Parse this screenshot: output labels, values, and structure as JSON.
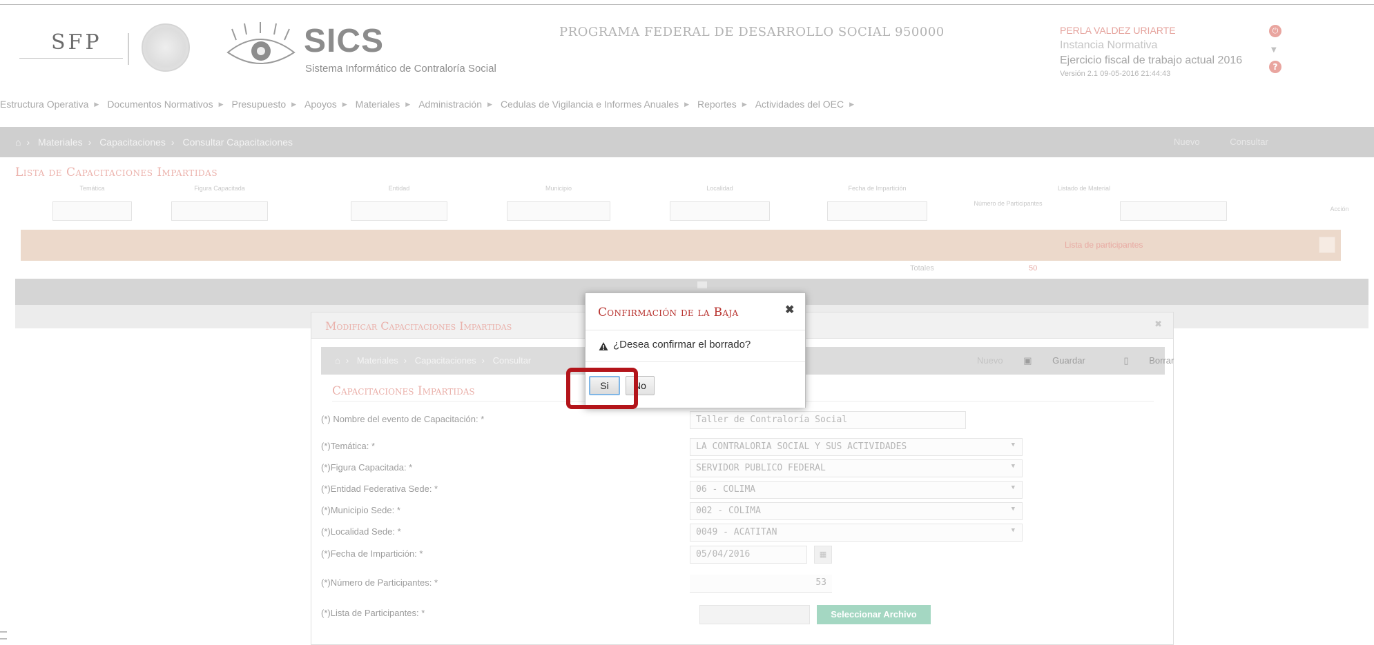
{
  "header": {
    "sfp_logo_text": "SFP",
    "app_title": "SICS",
    "app_subtitle": "Sistema Informático de Contraloría Social",
    "program": "PROGRAMA FEDERAL DE DESARROLLO SOCIAL 950000",
    "user": {
      "name": "PERLA VALDEZ URIARTE",
      "role": "Instancia Normativa",
      "fiscal_year": "Ejercicio fiscal de trabajo actual  2016",
      "version": "Versión 2.1   09-05-2016 21:44:43"
    }
  },
  "menu": [
    {
      "label": "Estructura Operativa"
    },
    {
      "label": "Documentos Normativos"
    },
    {
      "label": "Presupuesto"
    },
    {
      "label": "Apoyos"
    },
    {
      "label": "Materiales"
    },
    {
      "label": "Administración"
    },
    {
      "label": "Cedulas de Vigilancia e Informes Anuales"
    },
    {
      "label": "Reportes"
    },
    {
      "label": "Actividades del OEC"
    }
  ],
  "breadcrumb": {
    "items": [
      "Materiales",
      "Capacitaciones",
      "Consultar Capacitaciones"
    ],
    "tools": [
      "Nuevo",
      "Consultar"
    ]
  },
  "list": {
    "title": "Lista de Capacitaciones Impartidas",
    "columns": [
      "Temática",
      "Figura Capacitada",
      "Entidad",
      "Municipio",
      "Localidad",
      "Fecha de Impartición",
      "Número de Participantes",
      "Listado de Material",
      "Acción"
    ],
    "row_link": "Lista de participantes",
    "totals_label": "Totales",
    "totals_value": "50"
  },
  "modify": {
    "title": "Modificar Capacitaciones Impartidas",
    "breadcrumb": [
      "Materiales",
      "Capacitaciones",
      "Consultar"
    ],
    "tools": [
      "Nuevo",
      "Guardar",
      "Borrar"
    ],
    "section_title": "Capacitaciones Impartidas",
    "fields": [
      {
        "label": "(*) Nombre del evento de Capacitación: *",
        "value": "Taller de Contraloría Social"
      },
      {
        "label": "(*)Temática: *",
        "value": "LA CONTRALORIA SOCIAL Y SUS ACTIVIDADES"
      },
      {
        "label": "(*)Figura Capacitada: *",
        "value": "SERVIDOR PUBLICO FEDERAL"
      },
      {
        "label": "(*)Entidad Federativa Sede: *",
        "value": "06 - COLIMA"
      },
      {
        "label": "(*)Municipio Sede: *",
        "value": "002 - COLIMA"
      },
      {
        "label": "(*)Localidad Sede: *",
        "value": "0049 - ACATITAN"
      },
      {
        "label": "(*)Fecha de Impartición: *",
        "value": "05/04/2016"
      },
      {
        "label": "(*)Número de Participantes: *",
        "value": "53"
      },
      {
        "label": "(*)Lista de Participantes: *",
        "value": ""
      }
    ],
    "file_button": "Seleccionar Archivo"
  },
  "confirm": {
    "title": "Confirmación de la Baja",
    "message": "¿Desea confirmar el borrado?",
    "yes_label": "Si",
    "no_label": "No"
  },
  "colors": {
    "dialog_title": "#b8332f",
    "highlight": "#b3141a",
    "accent_pink": "#e5a39d",
    "file_button": "#a4d7c2"
  }
}
